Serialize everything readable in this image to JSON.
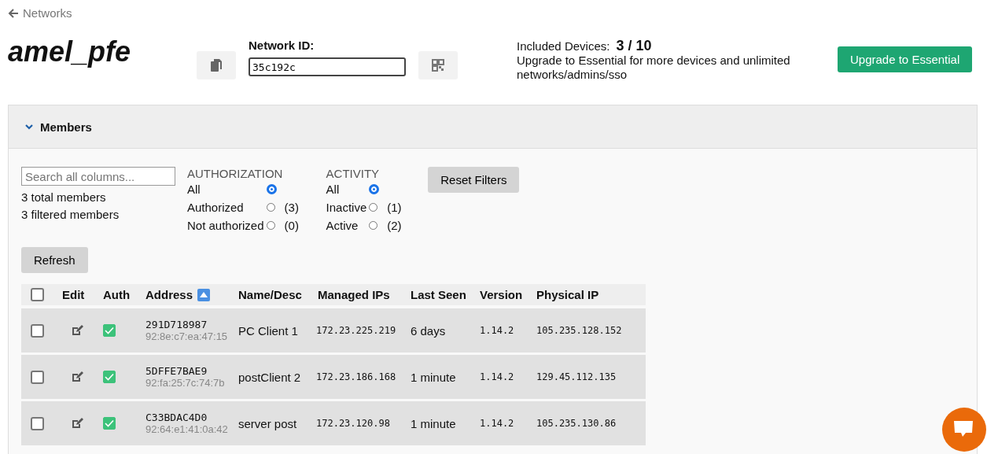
{
  "back_link": {
    "label": "Networks"
  },
  "network": {
    "name": "amel_pfe",
    "id_label": "Network ID:",
    "id_value": "35c192c"
  },
  "plan": {
    "devices_label": "Included Devices:",
    "devices_value": "3 / 10",
    "note": "Upgrade to Essential for more devices and unlimited networks/admins/sso",
    "upgrade_button": "Upgrade to Essential"
  },
  "members": {
    "title": "Members",
    "expanded": true,
    "search": {
      "placeholder": "Search all columns..."
    },
    "total": "3 total members",
    "filtered": "3 filtered members",
    "filters": [
      {
        "title": "AUTHORIZATION",
        "options": [
          {
            "label": "All",
            "selected": true
          },
          {
            "label": "Authorized",
            "count": "(3)",
            "selected": false
          },
          {
            "label": "Not authorized",
            "count": "(0)",
            "selected": false
          }
        ]
      },
      {
        "title": "ACTIVITY",
        "options": [
          {
            "label": "All",
            "selected": true
          },
          {
            "label": "Inactive",
            "count": "(1)",
            "selected": false
          },
          {
            "label": "Active",
            "count": "(2)",
            "selected": false
          }
        ]
      }
    ],
    "reset_button": "Reset Filters",
    "refresh_button": "Refresh",
    "table": {
      "all_checked": false,
      "columns": [
        {
          "label": "Edit",
          "sorted": false
        },
        {
          "label": "Auth",
          "sorted": false
        },
        {
          "label": "Address",
          "sorted": true
        },
        {
          "label": "Name/Desc",
          "sorted": false
        },
        {
          "label": "Managed IPs",
          "sorted": false
        },
        {
          "label": "Last Seen",
          "sorted": false
        },
        {
          "label": "Version",
          "sorted": false
        },
        {
          "label": "Physical IP",
          "sorted": false
        }
      ],
      "rows": [
        {
          "checked": false,
          "authorized": true,
          "address": "291D718987",
          "mac": "92:8e:c7:ea:47:15",
          "name": "PC Client 1",
          "managed_ip": "172.23.225.219",
          "last_seen": "6 days",
          "version": "1.14.2",
          "physical_ip": "105.235.128.152"
        },
        {
          "checked": false,
          "authorized": true,
          "address": "5DFFE7BAE9",
          "mac": "92:fa:25:7c:74:7b",
          "name": "postClient 2",
          "managed_ip": "172.23.186.168",
          "last_seen": "1 minute",
          "version": "1.14.2",
          "physical_ip": "129.45.112.135"
        },
        {
          "checked": false,
          "authorized": true,
          "address": "C33BDAC4D0",
          "mac": "92:64:e1:41:0a:42",
          "name": "server post",
          "managed_ip": "172.23.120.98",
          "last_seen": "1 minute",
          "version": "1.14.2",
          "physical_ip": "105.235.130.86"
        }
      ]
    }
  }
}
